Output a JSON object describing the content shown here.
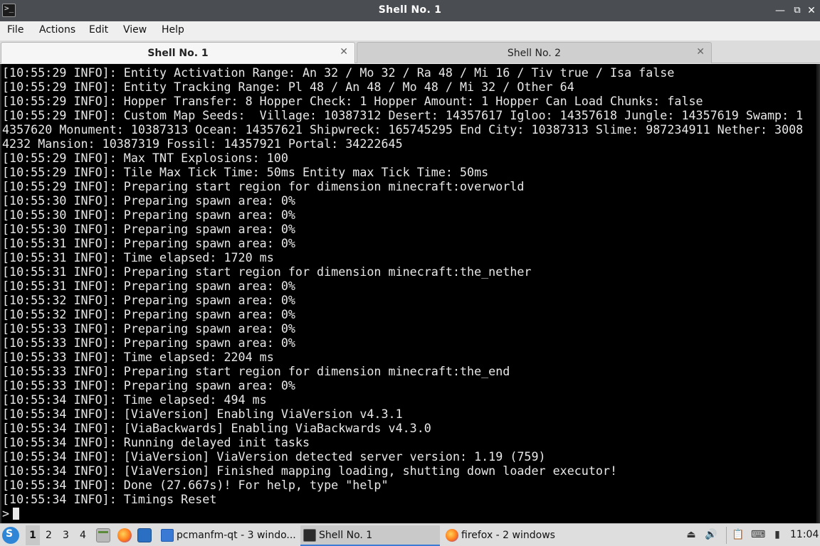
{
  "window": {
    "title": "Shell No. 1",
    "app_icon": "terminal-icon",
    "controls": {
      "minimize": "—",
      "maximize": "□",
      "restore": "⧉",
      "close": "✕"
    }
  },
  "menu": {
    "file": "File",
    "actions": "Actions",
    "edit": "Edit",
    "view": "View",
    "help": "Help"
  },
  "tabs": [
    {
      "label": "Shell No. 1",
      "active": true,
      "close": "✕"
    },
    {
      "label": "Shell No. 2",
      "active": false,
      "close": "✕"
    }
  ],
  "terminal": {
    "lines": [
      "[10:55:29 INFO]: Entity Activation Range: An 32 / Mo 32 / Ra 48 / Mi 16 / Tiv true / Isa false",
      "[10:55:29 INFO]: Entity Tracking Range: Pl 48 / An 48 / Mo 48 / Mi 32 / Other 64",
      "[10:55:29 INFO]: Hopper Transfer: 8 Hopper Check: 1 Hopper Amount: 1 Hopper Can Load Chunks: false",
      "[10:55:29 INFO]: Custom Map Seeds:  Village: 10387312 Desert: 14357617 Igloo: 14357618 Jungle: 14357619 Swamp: 1",
      "4357620 Monument: 10387313 Ocean: 14357621 Shipwreck: 165745295 End City: 10387313 Slime: 987234911 Nether: 3008",
      "4232 Mansion: 10387319 Fossil: 14357921 Portal: 34222645",
      "[10:55:29 INFO]: Max TNT Explosions: 100",
      "[10:55:29 INFO]: Tile Max Tick Time: 50ms Entity max Tick Time: 50ms",
      "[10:55:29 INFO]: Preparing start region for dimension minecraft:overworld",
      "[10:55:30 INFO]: Preparing spawn area: 0%",
      "[10:55:30 INFO]: Preparing spawn area: 0%",
      "[10:55:30 INFO]: Preparing spawn area: 0%",
      "[10:55:31 INFO]: Preparing spawn area: 0%",
      "[10:55:31 INFO]: Time elapsed: 1720 ms",
      "[10:55:31 INFO]: Preparing start region for dimension minecraft:the_nether",
      "[10:55:31 INFO]: Preparing spawn area: 0%",
      "[10:55:32 INFO]: Preparing spawn area: 0%",
      "[10:55:32 INFO]: Preparing spawn area: 0%",
      "[10:55:33 INFO]: Preparing spawn area: 0%",
      "[10:55:33 INFO]: Preparing spawn area: 0%",
      "[10:55:33 INFO]: Time elapsed: 2204 ms",
      "[10:55:33 INFO]: Preparing start region for dimension minecraft:the_end",
      "[10:55:33 INFO]: Preparing spawn area: 0%",
      "[10:55:34 INFO]: Time elapsed: 494 ms",
      "[10:55:34 INFO]: [ViaVersion] Enabling ViaVersion v4.3.1",
      "[10:55:34 INFO]: [ViaBackwards] Enabling ViaBackwards v4.3.0",
      "[10:55:34 INFO]: Running delayed init tasks",
      "[10:55:34 INFO]: [ViaVersion] ViaVersion detected server version: 1.19 (759)",
      "[10:55:34 INFO]: [ViaVersion] Finished mapping loading, shutting down loader executor!",
      "[10:55:34 INFO]: Done (27.667s)! For help, type \"help\"",
      "[10:55:34 INFO]: Timings Reset"
    ],
    "prompt": ">"
  },
  "taskbar": {
    "start_icon": "start-menu-icon",
    "start_glyph": "S",
    "workspaces": [
      "1",
      "2",
      "3",
      "4"
    ],
    "launchers": [
      "file-manager-icon",
      "firefox-icon",
      "show-desktop-icon"
    ],
    "tasks": [
      {
        "label": "pcmanfm-qt - 3 windo...",
        "icon": "folder-icon"
      },
      {
        "label": "Shell No. 1",
        "icon": "terminal-icon",
        "active": true
      },
      {
        "label": "firefox - 2 windows",
        "icon": "firefox-icon"
      }
    ],
    "tray": {
      "eject": "⏏",
      "volume": "🔊",
      "clipboard": "📋",
      "keyboard": "⌨",
      "network": "▮"
    },
    "clock": "11:04"
  },
  "colors": {
    "titlebar": "#4a4e53",
    "terminal_bg": "#000000",
    "terminal_fg": "#e8e8e8",
    "accent": "#3a7bd5"
  }
}
